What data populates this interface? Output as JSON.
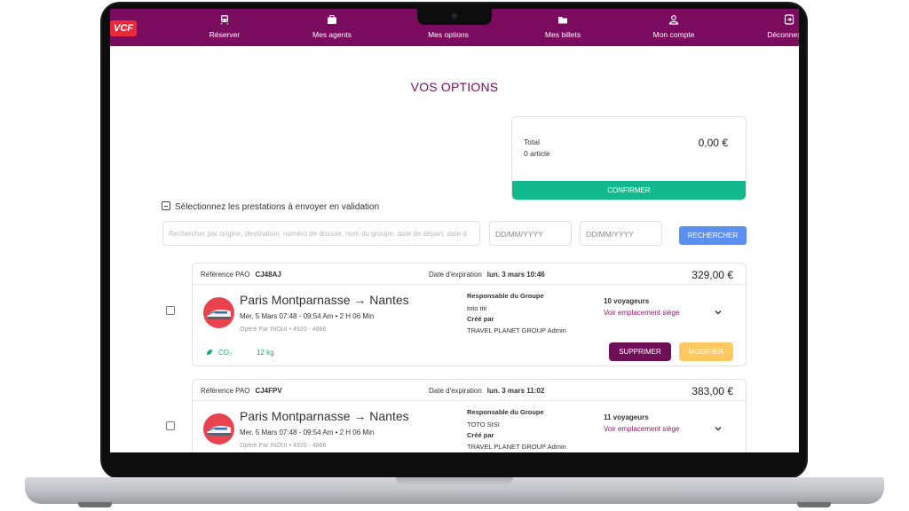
{
  "brand": {
    "logo_text": "VCF",
    "primary_color": "#7a0b5e",
    "accent_red": "#ec2b3a"
  },
  "nav": {
    "items": [
      {
        "label": "Réserver",
        "icon": "train-icon"
      },
      {
        "label": "Mes agents",
        "icon": "briefcase-icon"
      },
      {
        "label": "Mes options",
        "icon": "options-icon"
      },
      {
        "label": "Mes billets",
        "icon": "folder-icon"
      },
      {
        "label": "Mon compte",
        "icon": "user-icon"
      },
      {
        "label": "Déconnexion",
        "icon": "logout-icon"
      }
    ]
  },
  "page": {
    "title": "VOS OPTIONS"
  },
  "summary": {
    "total_label": "Total",
    "count": "0 article",
    "amount": "0,00 €",
    "confirm_label": "CONFIRMER",
    "confirm_color": "#12b98d"
  },
  "filters": {
    "select_label": "Sélectionnez les prestations à envoyer en validation",
    "search_placeholder": "Rechercher par origine, destination, numéro de dossier, nom du groupe, date de départ, date d",
    "date_from_placeholder": "DD/MM/YYYY",
    "date_to_placeholder": "DD/MM/YYYY",
    "search_button": "RECHERCHER"
  },
  "reservations": [
    {
      "ref_label": "Référence PAO",
      "ref": "CJ48AJ",
      "exp_label": "Date d'expiration",
      "exp": "lun. 3 mars 10:46",
      "price": "329,00 €",
      "route": "Paris Montparnasse → Nantes",
      "times": "Mer. 5 Mars 07:48 - 09:54 Am • 2 H 06 Min",
      "operator": "Opéré Par INOUI • 4920 - 4866",
      "resp_label": "Responsable du Groupe",
      "resp_name": "toto titi",
      "created_label": "Créé par",
      "created_name": "TRAVEL PLANET GROUP Admin",
      "travelers": "10 voyageurs",
      "seat_link": "Voir emplacement siège",
      "co2_label": "CO₂",
      "co2_value": "12 kg",
      "delete_label": "SUPPRIMER",
      "modify_label": "MODIFIER"
    },
    {
      "ref_label": "Référence PAO",
      "ref": "CJ4FPV",
      "exp_label": "Date d'expiration",
      "exp": "lun. 3 mars 11:02",
      "price": "383,00 €",
      "route": "Paris Montparnasse → Nantes",
      "times": "Mer. 5 Mars 07:48 - 09:54 Am • 2 H 06 Min",
      "operator": "Opéré Par INOUI • 4920 - 4866",
      "resp_label": "Responsable du Groupe",
      "resp_name": "TOTO SISI",
      "created_label": "Créé par",
      "created_name": "TRAVEL PLANET GROUP Admin",
      "travelers": "11 voyageurs",
      "seat_link": "Voir emplacement siège"
    }
  ]
}
